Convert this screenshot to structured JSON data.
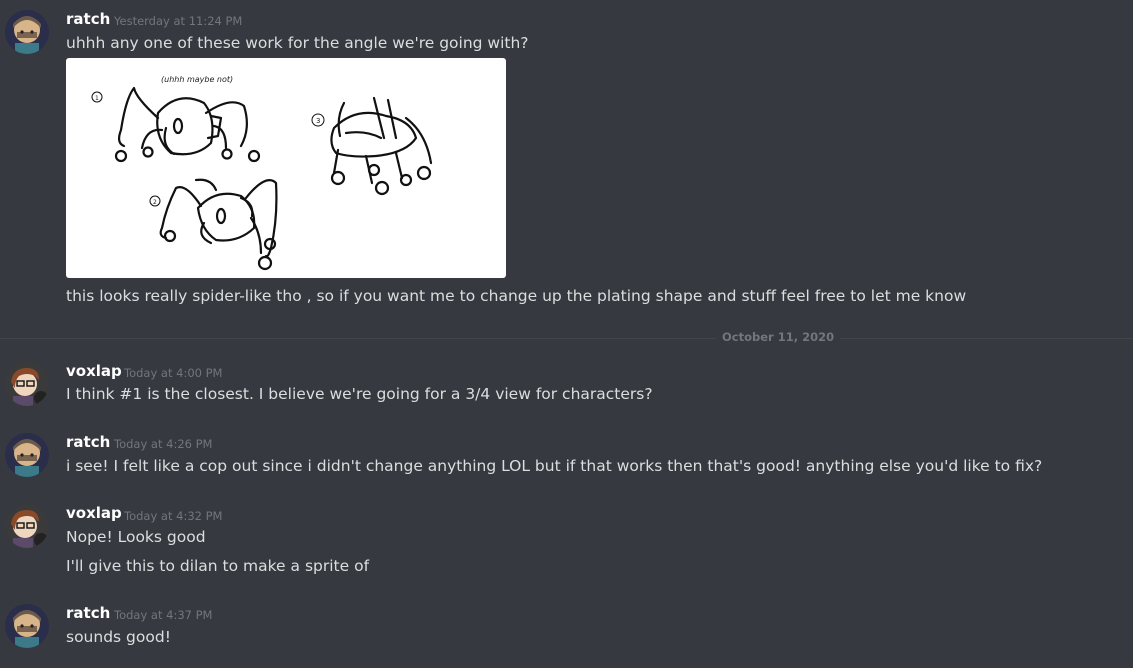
{
  "messages": [
    {
      "author": "ratch",
      "timestamp": "Yesterday at 11:24 PM",
      "lines": [
        "uhhh any one of these work for the angle we're going with?"
      ],
      "attachment": {
        "caption": "(uhhh maybe not)",
        "labels": [
          "1",
          "2",
          "3"
        ]
      },
      "followup": "this looks really spider-like tho , so if you want me to change up the plating shape and stuff feel free to let me know"
    },
    {
      "author": "voxlap",
      "timestamp": "Today at 4:00 PM",
      "lines": [
        "I think #1 is the closest. I believe we're going for a 3/4 view for characters?"
      ]
    },
    {
      "author": "ratch",
      "timestamp": "Today at 4:26 PM",
      "lines": [
        "i see! I felt like a cop out since i didn't change anything LOL but if  that works then that's good! anything else you'd like to fix?"
      ]
    },
    {
      "author": "voxlap",
      "timestamp": "Today at 4:32 PM",
      "lines": [
        "Nope! Looks good",
        "I'll give this to dilan to make a sprite of"
      ]
    },
    {
      "author": "ratch",
      "timestamp": "Today at 4:37 PM",
      "lines": [
        "sounds good!"
      ]
    }
  ],
  "date_divider": "October 11, 2020",
  "colors": {
    "background": "#36393f",
    "username": "#ffffff",
    "timestamp": "#72767d",
    "message_text": "#dcddde",
    "divider_line": "#42454a"
  },
  "icons": {
    "ratch_avatar": "avatar-ratch-icon",
    "voxlap_avatar": "avatar-voxlap-icon"
  }
}
